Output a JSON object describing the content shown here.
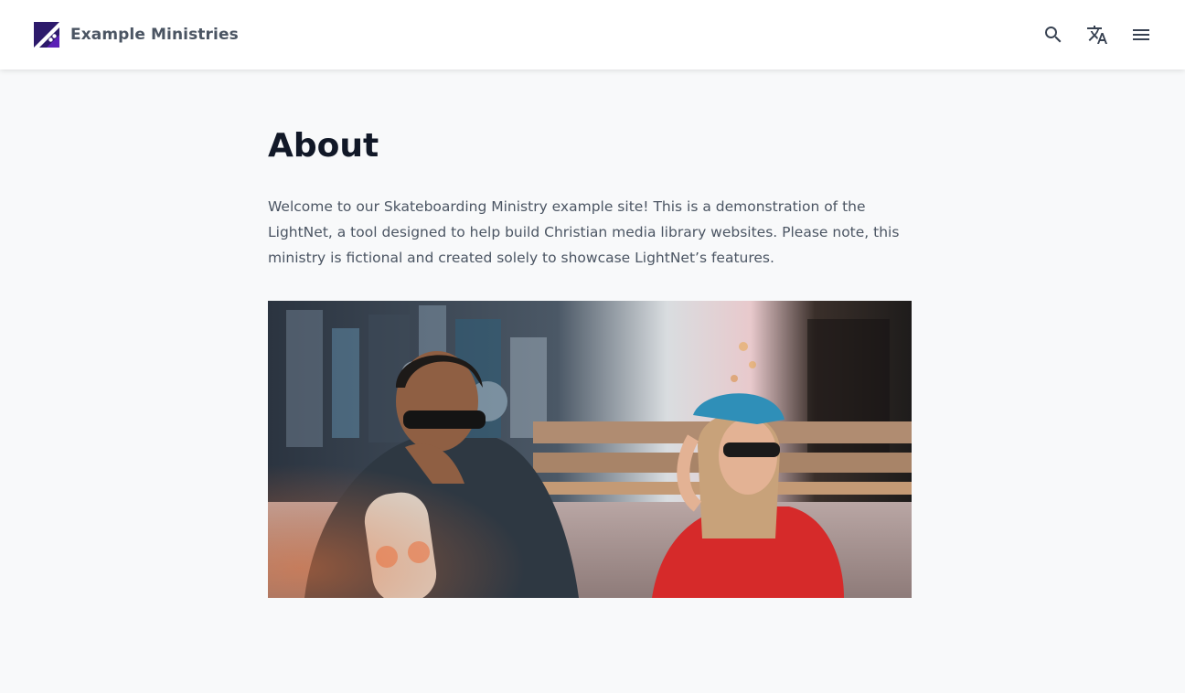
{
  "header": {
    "site_name": "Example Ministries",
    "logo_icon": "skateboard-logo-icon",
    "brand_color": "#2d1a6b",
    "actions": [
      {
        "name": "search-icon",
        "label": "Search"
      },
      {
        "name": "translate-icon",
        "label": "Language"
      },
      {
        "name": "menu-icon",
        "label": "Menu"
      }
    ]
  },
  "main": {
    "title": "About",
    "intro": "Welcome to our Skateboarding Ministry example site! This is a demonstration of the LightNet, a tool designed to help build Christian media library websites. Please note, this ministry is fictional and created solely to showcase LightNet’s features.",
    "hero_image_alt": "Two skateboarders sitting in front of a shop window"
  }
}
